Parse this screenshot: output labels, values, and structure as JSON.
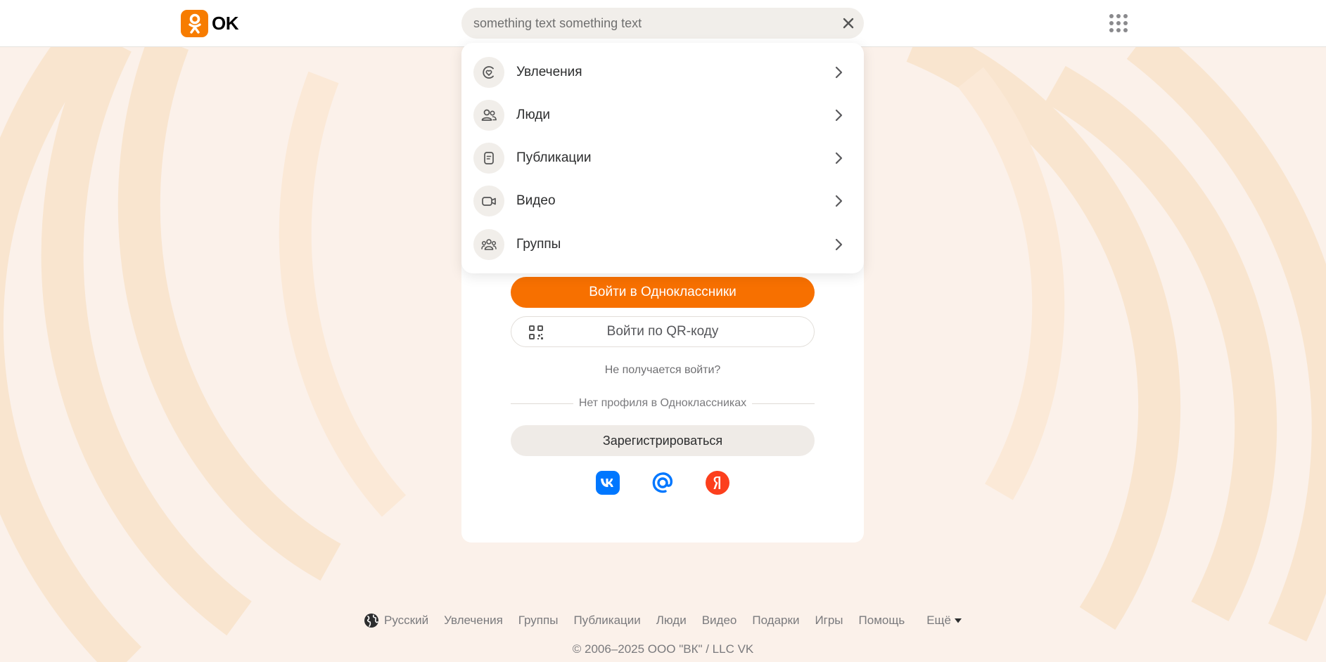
{
  "brand": {
    "name": "OK",
    "accent": "#f77000"
  },
  "search": {
    "value": "something text something text",
    "placeholder": ""
  },
  "dropdown": {
    "items": [
      {
        "label": "Увлечения",
        "icon": "hobbies-icon"
      },
      {
        "label": "Люди",
        "icon": "people-icon"
      },
      {
        "label": "Публикации",
        "icon": "publications-icon"
      },
      {
        "label": "Видео",
        "icon": "video-icon"
      },
      {
        "label": "Группы",
        "icon": "groups-icon"
      }
    ]
  },
  "login": {
    "login_button": "Войти в Одноклассники",
    "qr_button": "Войти по QR-коду",
    "trouble_link": "Не получается войти?",
    "no_profile_text": "Нет профиля в Одноклассниках",
    "register_button": "Зарегистрироваться",
    "socials": [
      "vk-icon",
      "mail-icon",
      "yandex-icon"
    ]
  },
  "footer": {
    "language": "Русский",
    "links": [
      "Увлечения",
      "Группы",
      "Публикации",
      "Люди",
      "Видео",
      "Подарки",
      "Игры",
      "Помощь"
    ],
    "more": "Ещё",
    "copyright": "© 2006–2025 ООО \"ВК\" / LLC VK"
  }
}
